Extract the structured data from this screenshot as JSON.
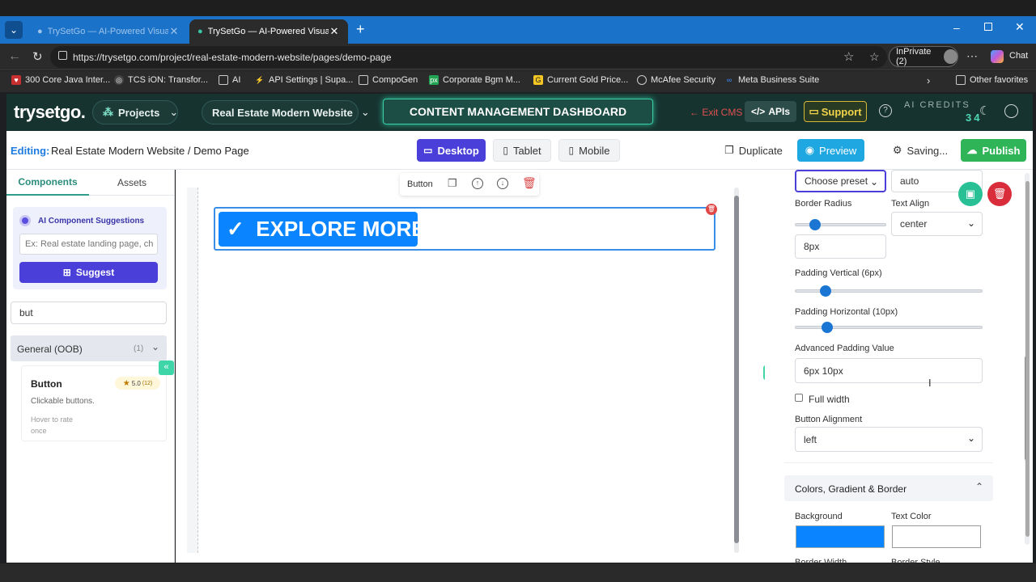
{
  "browser": {
    "tabs": [
      {
        "title": "TrySetGo — AI-Powered Visual CMS"
      },
      {
        "title": "TrySetGo — AI-Powered Visual CMS"
      }
    ],
    "url": "https://trysetgo.com/project/real-estate-modern-website/pages/demo-page",
    "inprivate": "InPrivate (2)",
    "chat": "Chat",
    "favorites": [
      "300 Core Java Inter...",
      "TCS iON: Transfor...",
      "AI",
      "API Settings | Supa...",
      "CompoGen",
      "Corporate Bgm M...",
      "Current Gold Price...",
      "McAfee Security",
      "Meta Business Suite"
    ],
    "other_favorites": "Other favorites"
  },
  "header": {
    "logo": "trysetgo.",
    "projects": "Projects",
    "project_name": "Real Estate Modern Website",
    "dashboard": "CONTENT MANAGEMENT DASHBOARD",
    "exit": "← Exit CMS",
    "apis": "APIs",
    "support": "Support",
    "credits_label": "AI CREDITS",
    "credits_value": "34"
  },
  "editor": {
    "editing_label": "Editing:",
    "editing_path": "Real Estate Modern Website / Demo Page",
    "desktop": "Desktop",
    "tablet": "Tablet",
    "mobile": "Mobile",
    "duplicate": "Duplicate",
    "preview": "Preview",
    "saving": "Saving...",
    "publish": "Publish"
  },
  "left": {
    "tab_components": "Components",
    "tab_assets": "Assets",
    "ai_title": "AI Component Suggestions",
    "ai_placeholder": "Ex: Real estate landing page, ch",
    "suggest": "Suggest",
    "search_value": "but",
    "group_name": "General (OOB)",
    "group_count": "(1)",
    "card_title": "Button",
    "card_rating": "5.0",
    "card_reviews": "(12)",
    "card_desc": "Clickable buttons.",
    "card_hover_1": "Hover to rate",
    "card_hover_2": "once"
  },
  "canvas": {
    "toolbar_label": "Button",
    "button_text": "✓  EXPLORE MORE"
  },
  "right": {
    "preset": "Choose preset",
    "auto": "auto",
    "border_radius_label": "Border Radius",
    "border_radius_value": "8px",
    "border_radius_level": 0.22,
    "text_align_label": "Text Align",
    "text_align_value": "center",
    "pad_v_label": "Padding Vertical (6px)",
    "pad_v_level": 0.16,
    "pad_h_label": "Padding Horizontal (10px)",
    "pad_h_level": 0.17,
    "adv_pad_label": "Advanced Padding Value",
    "adv_pad_value": "6px 10px",
    "full_width": "Full width",
    "align_label": "Button Alignment",
    "align_value": "left",
    "section_colors": "Colors, Gradient & Border",
    "bg_label": "Background",
    "text_color_label": "Text Color",
    "border_width_label": "Border Width",
    "border_style_label": "Border Style",
    "bg_color": "#0a84ff",
    "text_color": "#ffffff"
  },
  "colors": {
    "accent": "#1e7be0",
    "brand_teal": "#17332f",
    "purple": "#4a3fd8",
    "green": "#2fb457"
  }
}
